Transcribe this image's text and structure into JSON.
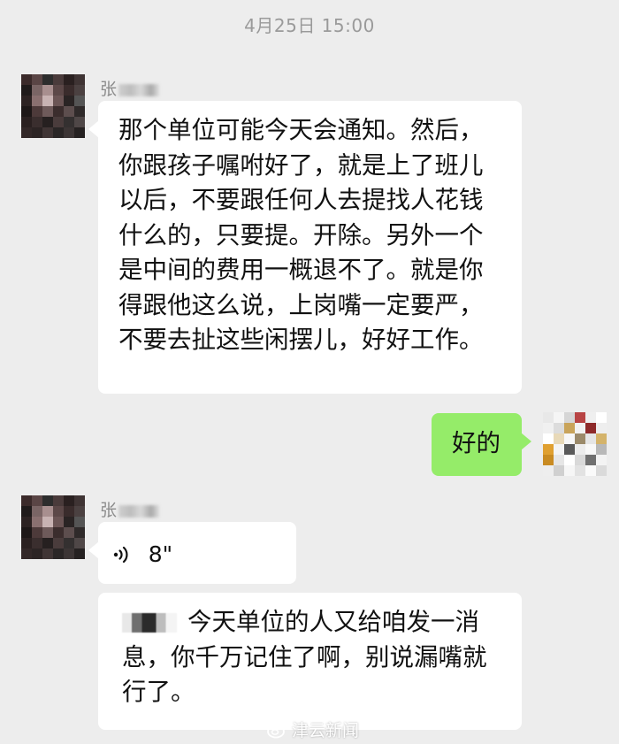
{
  "timestamp": "4月25日 15:00",
  "messages": [
    {
      "sender_name": "张",
      "text": "那个单位可能今天会通知。然后，\n你跟孩子嘱咐好了，就是上了班儿\n以后，不要跟任何人去提找人花钱\n什么的，只要提。开除。另外一个\n是中间的费用一概退不了。就是你\n得跟他这么说，上岗嘴一定要严，\n不要去扯这些闲摆儿，好好工作。"
    },
    {
      "self_text": "好的"
    },
    {
      "sender_name": "张",
      "voice_duration": "8\"",
      "text": "今天单位的人又给咱发一消\n息，你千万记住了啊，别说漏嘴就\n行了。"
    }
  ],
  "watermark": "津云新闻",
  "icons": {
    "voice": "voice-wave-icon",
    "watermark": "weibo-logo-icon"
  },
  "colors": {
    "background": "#ededed",
    "bubble_incoming": "#ffffff",
    "bubble_outgoing": "#95ec69",
    "timestamp": "#9a9a9a"
  }
}
